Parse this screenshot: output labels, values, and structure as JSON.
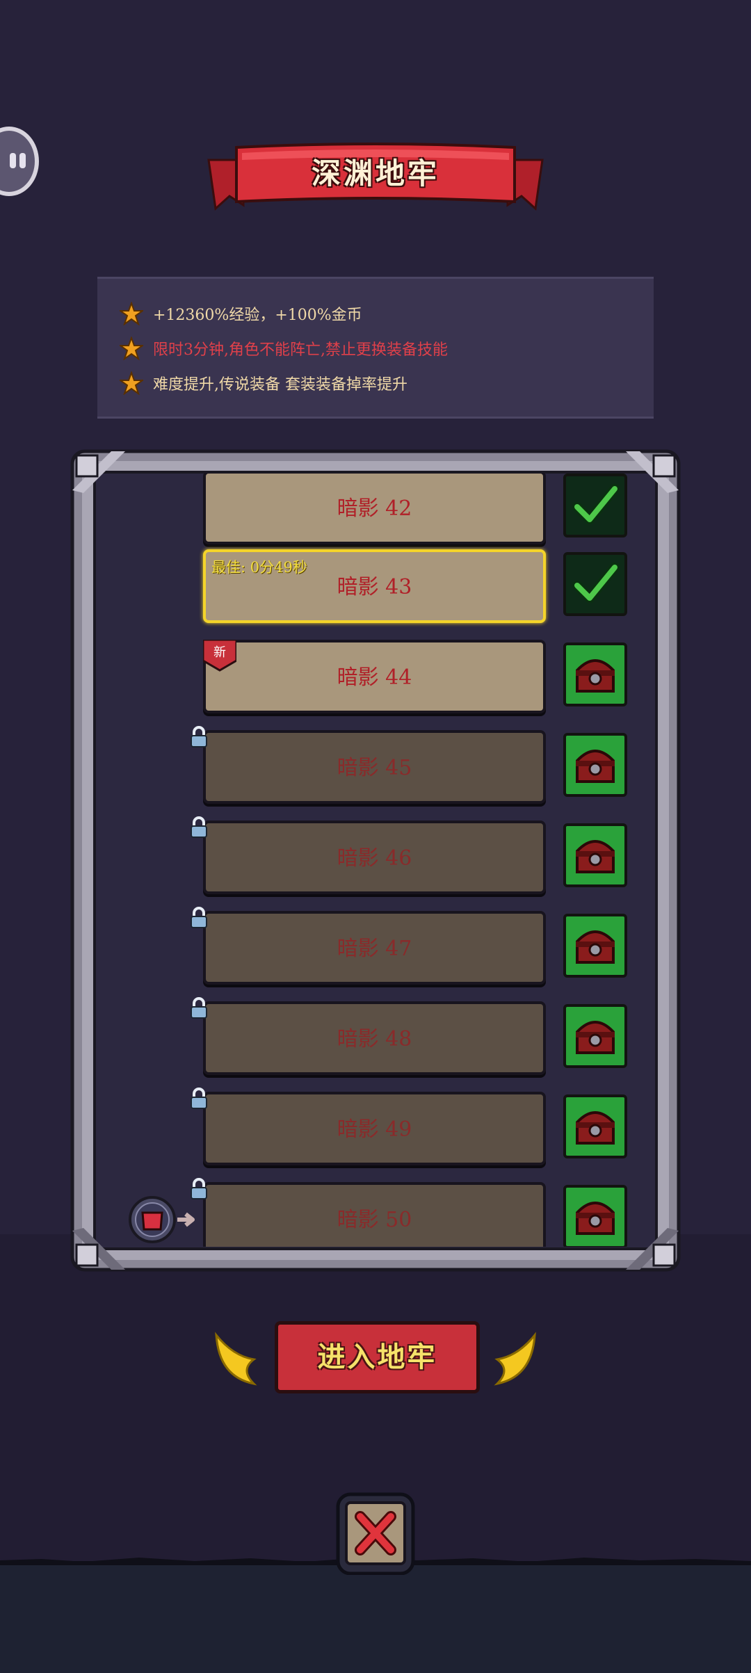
{
  "title": "深渊地牢",
  "info": [
    {
      "text": "+12360%经验，+100%金币",
      "color": "#f0d9a8"
    },
    {
      "text": "限时3分钟,角色不能阵亡,禁止更换装备技能",
      "color": "#e0404a"
    },
    {
      "text": "难度提升,传说装备 套装装备掉率提升",
      "color": "#f0d9a8"
    }
  ],
  "levels": [
    {
      "name": "暗影 42",
      "state": "cleared"
    },
    {
      "name": "暗影 43",
      "state": "cleared",
      "best": "最佳: 0分49秒"
    },
    {
      "name": "暗影 44",
      "state": "open",
      "tag": "新"
    },
    {
      "name": "暗影 45",
      "state": "locked"
    },
    {
      "name": "暗影 46",
      "state": "locked"
    },
    {
      "name": "暗影 47",
      "state": "locked"
    },
    {
      "name": "暗影 48",
      "state": "locked"
    },
    {
      "name": "暗影 49",
      "state": "locked"
    },
    {
      "name": "暗影 50",
      "state": "locked"
    }
  ],
  "enter_button": "进入地牢",
  "icons": {
    "pause": "pause-icon",
    "star": "star-icon",
    "lock": "lock-icon",
    "check": "checkmark-icon",
    "chest": "treasure-chest-icon",
    "close": "close-icon",
    "hero": "armor-hero-icon"
  },
  "colors": {
    "accent_red": "#c8303a",
    "gold": "#f4d42a",
    "reward_green": "#2aa23a"
  }
}
